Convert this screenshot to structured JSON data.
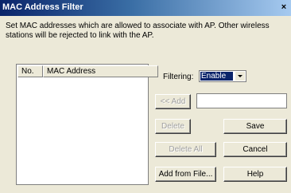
{
  "window": {
    "title": "MAC Address Filter",
    "close_glyph": "×"
  },
  "description": "Set MAC addresses which are allowed to associate with AP. Other wireless stations will be rejected to link with the AP.",
  "table": {
    "columns": [
      "No.",
      "MAC Address"
    ],
    "rows": []
  },
  "filtering": {
    "label": "Filtering:",
    "value": "Enable"
  },
  "mac_input": {
    "value": ""
  },
  "buttons": {
    "add": "<< Add",
    "delete": "Delete",
    "delete_all": "Delete All",
    "add_from_file": "Add from File...",
    "save": "Save",
    "cancel": "Cancel",
    "help": "Help"
  }
}
